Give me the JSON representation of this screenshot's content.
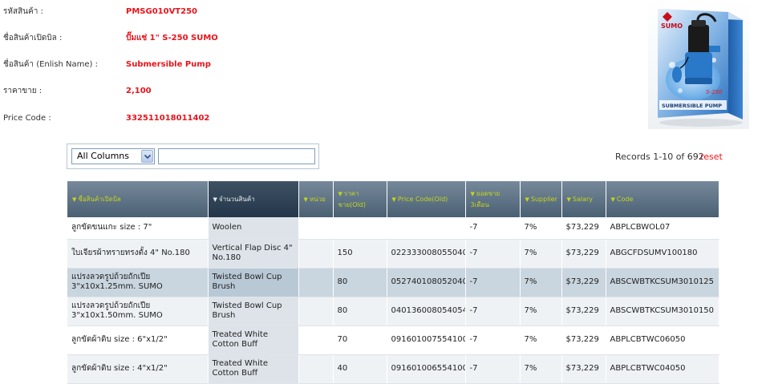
{
  "product": {
    "fields": [
      {
        "label": "รหัสสินค้า :",
        "value": "PMSG010VT250"
      },
      {
        "label": "ชื่อสินค้าเปิดบิล :",
        "value": "ปั๊มแช่ 1\" S-250 SUMO"
      },
      {
        "label": "ชื่อสินค้า (Enlish Name) :",
        "value": "Submersible Pump"
      },
      {
        "label": "ราคาขาย :",
        "value": "2,100"
      },
      {
        "label": "Price Code :",
        "value": "332511018011402"
      }
    ],
    "image": {
      "brand": "SUMO",
      "model": "S-250",
      "caption": "SUBMERSIBLE PUMP",
      "colors": {
        "box": "#3c8bd6",
        "pump_blue": "#2a78c8",
        "pump_black": "#1a1a1a"
      }
    }
  },
  "search": {
    "column_select": "All Columns",
    "input_value": ""
  },
  "records": {
    "label": "Records 1-10 of 692",
    "reset": "reset"
  },
  "table": {
    "headers": [
      "ชื่อสินค้าเปิดบิล",
      "จำนวนสินค้า",
      "หน่วย",
      "ราคาขาย(Old)",
      "Price Code(Old)",
      "ยอดขาย 3เดือน",
      "Supplier",
      "Salary",
      "Code"
    ],
    "rows": [
      [
        "ลูกขัดขนแกะ size : 7\"",
        "Woolen",
        "",
        "",
        "",
        "-7",
        "7%",
        "$73,229",
        "ABPLCBWOL07"
      ],
      [
        "ใบเจียรผ้าทรายทรงตั้ง 4\" No.180",
        "Vertical Flap Disc 4\" No.180",
        "",
        "150",
        "022333008055040",
        "-7",
        "7%",
        "$73,229",
        "ABGCFDSUMV100180"
      ],
      [
        "แปรงลวดรูปถ้วยถักเปีย 3\"x10x1.25mm. SUMO",
        "Twisted Bowl Cup Brush",
        "",
        "80",
        "052740108052040",
        "-7",
        "7%",
        "$73,229",
        "ABSCWBTKCSUM3010125"
      ],
      [
        "แปรงลวดรูปถ้วยถักเปีย 3\"x10x1.50mm. SUMO",
        "Twisted Bowl Cup Brush",
        "",
        "80",
        "040136008054054",
        "-7",
        "7%",
        "$73,229",
        "ABSCWBTKCSUM3010150"
      ],
      [
        "ลูกขัดผ้าดิบ size : 6\"x1/2\"",
        "Treated White Cotton Buff",
        "",
        "70",
        "091601007554100",
        "-7",
        "7%",
        "$73,229",
        "ABPLCBTWC06050"
      ],
      [
        "ลูกขัดผ้าดิบ size : 4\"x1/2\"",
        "Treated White Cotton Buff",
        "",
        "40",
        "091601006554100",
        "-7",
        "7%",
        "$73,229",
        "ABPLCBTWC04050"
      ]
    ]
  }
}
